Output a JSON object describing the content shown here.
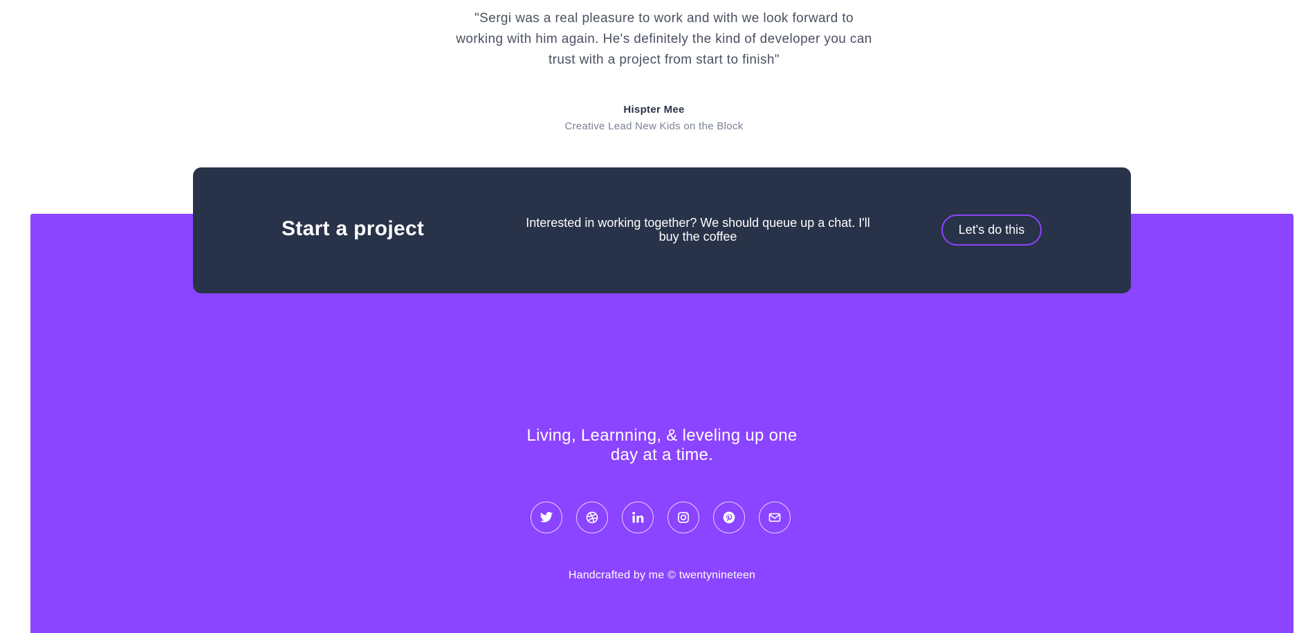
{
  "testimonial": {
    "quote_lines": [
      "\"Sergi was a real pleasure to work and with we look forward to",
      "working with him again. He's definitely the kind of developer you can",
      "trust with a project from start to finish\""
    ],
    "author_name": "Hispter Mee",
    "author_role": "Creative Lead New Kids on the Block"
  },
  "cta": {
    "title": "Start a project",
    "text": "Interested in working together? We should queue up a chat. I'll buy the coffee",
    "button_label": "Let's do this"
  },
  "footer": {
    "tagline_lines": [
      "Living, Learnning, & leveling up one",
      "day at a time."
    ],
    "socials": [
      {
        "icon": "twitter-icon"
      },
      {
        "icon": "dribbble-icon"
      },
      {
        "icon": "linkedin-icon"
      },
      {
        "icon": "instagram-icon"
      },
      {
        "icon": "pinterest-icon"
      },
      {
        "icon": "email-icon"
      }
    ],
    "credit": "Handcrafted by me © twentynineteen"
  },
  "colors": {
    "accent": "#8b44ff",
    "cta_background": "#283248",
    "text_dark": "#2b3346",
    "text_muted": "#7a8194"
  }
}
